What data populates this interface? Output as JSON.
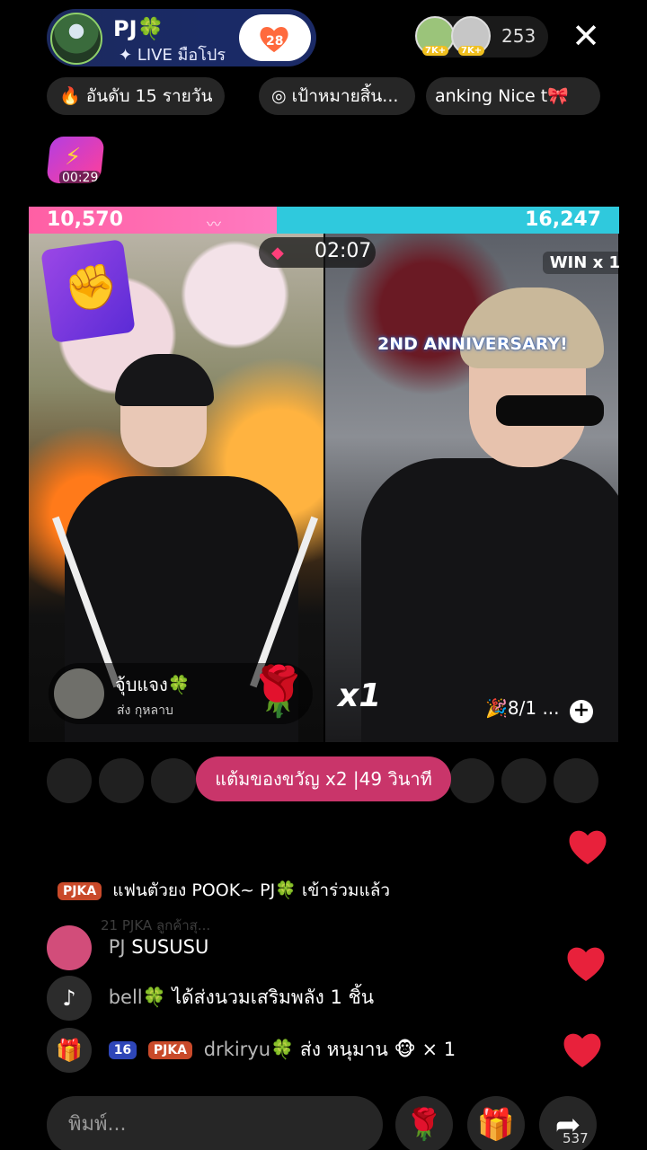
{
  "host": {
    "name": "PJ🍀",
    "subtitle": "✦ LIVE มือโปร",
    "hearts": "28"
  },
  "viewers": {
    "badge1": "7K+",
    "badge2": "7K+",
    "count": "253"
  },
  "close_glyph": "✕",
  "chips": [
    {
      "icon": "🔥",
      "label": "อันดับ 15 รายวัน"
    },
    {
      "icon": "◎",
      "label": "เป้าหมายสิ้น..."
    },
    {
      "label": "anking Nice t🎀"
    }
  ],
  "boost": {
    "time": "00:29"
  },
  "battle": {
    "left_score": "10,570",
    "right_score": "16,247",
    "left_share": 0.42,
    "timer": "02:07",
    "win": "WIN x 1",
    "banner": "2ND ANNIVERSARY!"
  },
  "gifter": {
    "name": "จุ้บแจง🍀",
    "action": "ส่ง กุหลาบ"
  },
  "multiplier": "x1",
  "goal": "🎉8/1 ...",
  "bonus": "แต้มของขวัญ x2 |49 วินาที",
  "chat": {
    "join": {
      "tag": "PJKA",
      "text": "แฟนตัวยง POOK~ PJ🍀 เข้าร่วมแล้ว"
    },
    "faded_line": "21 PJKA ลูกค้าสุ...",
    "messages": [
      {
        "icon": "avatar",
        "user": "PJ",
        "text": "SUSUSU"
      },
      {
        "icon": "♪",
        "user": "bell🍀",
        "text": "ได้ส่งนวมเสริมพลัง 1 ชิ้น"
      },
      {
        "icon": "🎁",
        "level": "16",
        "tag": "PJKA",
        "user": "drkiryu🍀",
        "text": "ส่ง หนุมาน 🐵 × 1"
      }
    ]
  },
  "input_placeholder": "พิมพ์...",
  "share_count": "537",
  "colors": {
    "pink": "#ff5fa4",
    "cyan": "#2fc9dd",
    "heart": "#e8213b"
  }
}
